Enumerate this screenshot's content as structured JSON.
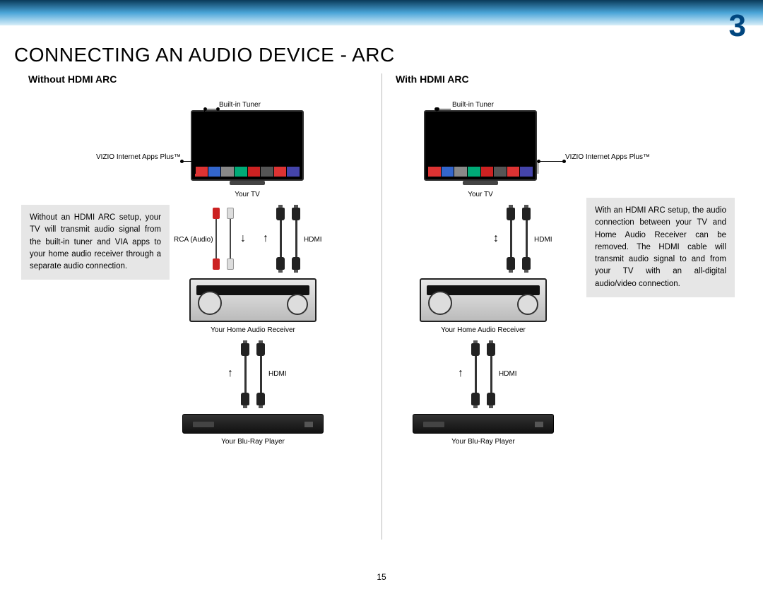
{
  "section_number": "3",
  "title": "CONNECTING AN AUDIO DEVICE - ARC",
  "page_number": "15",
  "left": {
    "heading": "Without HDMI ARC",
    "tuner_callout": "Built-in Tuner",
    "apps_callout": "VIZIO Internet  Apps Plus™",
    "tv_label": "Your TV",
    "cable_rca": "RCA (Audio)",
    "cable_hdmi_top": "HDMI",
    "receiver_label": "Your Home Audio Receiver",
    "cable_hdmi_bottom": "HDMI",
    "bluray_label": "Your Blu-Ray Player",
    "info": "Without an HDMI ARC setup, your TV will transmit audio signal from the built-in tuner and VIA apps to your home audio receiver through a separate audio connection."
  },
  "right": {
    "heading": "With HDMI ARC",
    "tuner_callout": "Built-in Tuner",
    "apps_callout": "VIZIO Internet  Apps Plus™",
    "tv_label": "Your TV",
    "cable_hdmi_top": "HDMI",
    "receiver_label": "Your Home Audio Receiver",
    "cable_hdmi_bottom": "HDMI",
    "bluray_label": "Your Blu-Ray Player",
    "info": "With an HDMI ARC setup, the audio connection between your TV and Home Audio Receiver can be removed. The HDMI cable will transmit audio signal to and from your TV with an all-digital audio/video connection."
  }
}
